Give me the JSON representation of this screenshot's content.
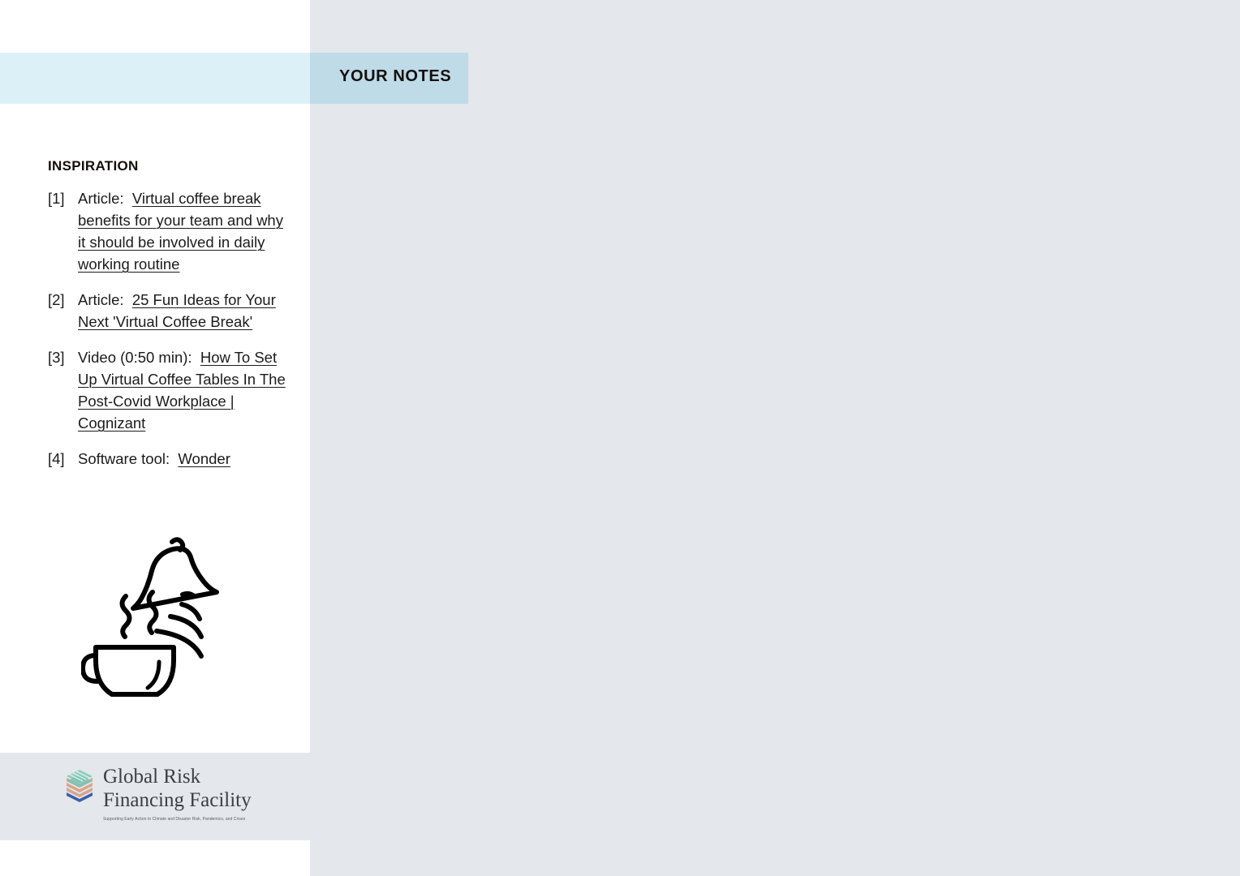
{
  "header": {
    "notes_title": "YOUR NOTES"
  },
  "colors": {
    "page_background": "#e4e7eb",
    "panel_background": "#ffffff",
    "header_band_light": "#dcf0f7",
    "header_band_dark": "#bfdbe8",
    "text": "#1b1b1b",
    "logo_text": "#3b3f45",
    "logo_green": "#8fcfbf",
    "logo_tan": "#d8a58c",
    "logo_blue": "#3c5fa8"
  },
  "inspiration": {
    "heading": "INSPIRATION",
    "items": [
      {
        "marker": "[1]",
        "label": "Article:",
        "link": "Virtual coffee break benefits for your team and why it should be involved in daily working routine"
      },
      {
        "marker": "[2]",
        "label": "Article:",
        "link": "25 Fun Ideas for Your Next 'Virtual Coffee Break'"
      },
      {
        "marker": "[3]",
        "label": "Video (0:50 min):",
        "link": "How To Set Up Virtual Coffee Tables In The Post-Covid Workplace | Cognizant"
      },
      {
        "marker": "[4]",
        "label": "Software tool:",
        "link": "Wonder"
      }
    ]
  },
  "illustration": {
    "name": "coffee-cup-with-ringing-bell"
  },
  "footer": {
    "logo": {
      "line1": "Global Risk",
      "line2": "Financing Facility",
      "tagline": "Supporting Early Action to Climate and Disaster Risk, Pandemics, and Crises"
    }
  }
}
